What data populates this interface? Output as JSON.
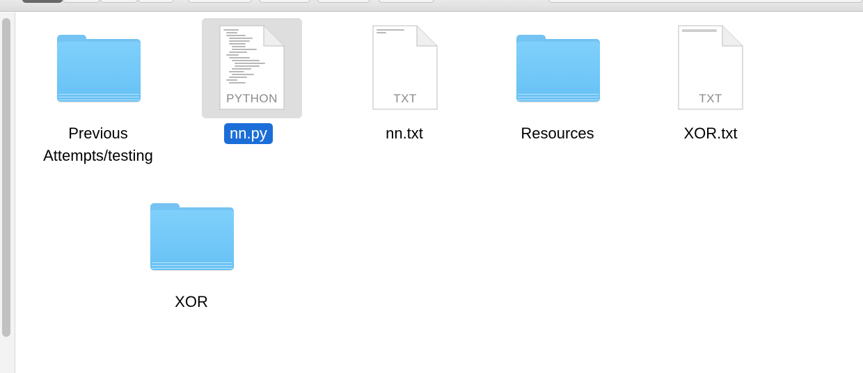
{
  "window": {
    "toolbar_controls": [
      "view-toggle",
      "view-toggle",
      "view-toggle",
      "action",
      "action",
      "action",
      "action",
      "search"
    ]
  },
  "items": [
    {
      "name": "Previous Attempts/testing",
      "line1": "Previous",
      "line2": "Attempts/testing",
      "kind": "folder",
      "selected": false
    },
    {
      "name": "nn.py",
      "kind": "document",
      "ext": "PYTHON",
      "selected": true
    },
    {
      "name": "nn.txt",
      "kind": "document",
      "ext": "TXT",
      "selected": false
    },
    {
      "name": "Resources",
      "kind": "folder",
      "selected": false
    },
    {
      "name": "XOR.txt",
      "kind": "document",
      "ext": "TXT",
      "selected": false
    },
    {
      "name": "XOR",
      "kind": "folder",
      "selected": false
    }
  ],
  "colors": {
    "selection": "#1b6ed8",
    "folder": "#74c3f2",
    "icon_highlight": "#dedede"
  }
}
